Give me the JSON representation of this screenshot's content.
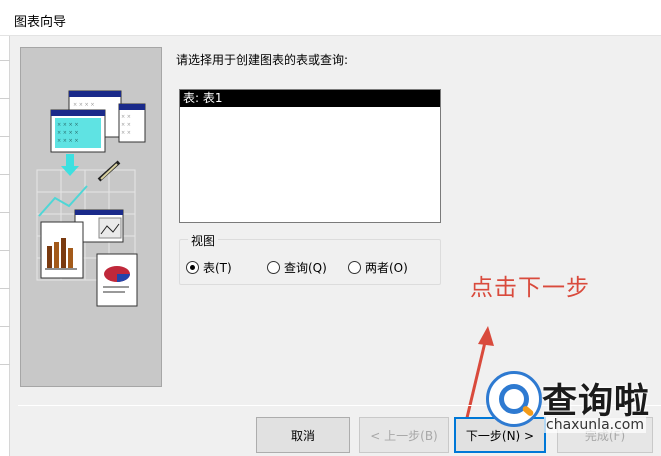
{
  "window": {
    "title": "图表向导"
  },
  "prompt": "请选择用于创建图表的表或查询:",
  "list": {
    "items": [
      {
        "label": "表: 表1",
        "selected": true
      }
    ]
  },
  "view": {
    "legend": "视图",
    "options": [
      {
        "label": "表(T)",
        "checked": true
      },
      {
        "label": "查询(Q)",
        "checked": false
      },
      {
        "label": "两者(O)",
        "checked": false
      }
    ]
  },
  "buttons": {
    "cancel": "取消",
    "back": "< 上一步(B)",
    "next": "下一步(N) >",
    "finish": "完成(F)"
  },
  "annotation": {
    "text": "点击下一步",
    "color": "#d94a3c"
  },
  "watermark": {
    "brand": "查询啦",
    "domain": "chaxunla.com"
  }
}
